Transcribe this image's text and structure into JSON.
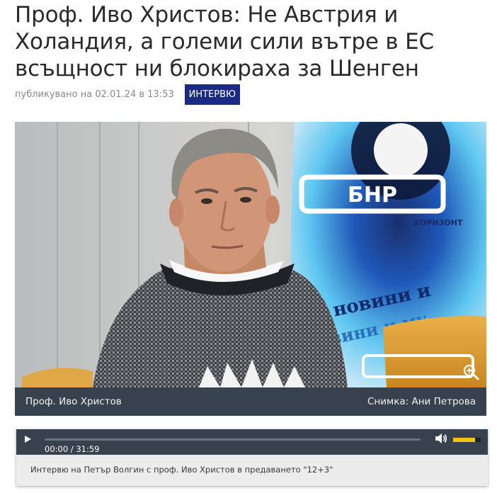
{
  "article": {
    "title": "Проф. Иво Христов: Не Австрия и Холандия, а големи сили вътре в ЕС всъщност ни блокираха за Шенген",
    "published": "публикувано на 02.01.24 в 13:53",
    "category": "Интервю"
  },
  "photo": {
    "caption": "Проф. Иво Христов",
    "credit": "Снимка: Ани Петрова",
    "logo_text": "БНР",
    "logo_sub": "ХОРИЗОНТ",
    "banner_text_1": "новини и",
    "banner_text_2": "вини и му",
    "zoom_icon": "zoom-in-icon"
  },
  "player": {
    "time": "00:00 / 31:59",
    "progress": 0.0,
    "volume": 0.8,
    "title": "Интервю на Петър Волгин с проф. Иво Христов в предаването \"12+3\"",
    "play_icon": "play-icon",
    "volume_icon": "speaker-icon"
  },
  "colors": {
    "badge": "#1b2a85",
    "caption_bar": "#38424e",
    "volume_fill": "#f1c40f"
  }
}
